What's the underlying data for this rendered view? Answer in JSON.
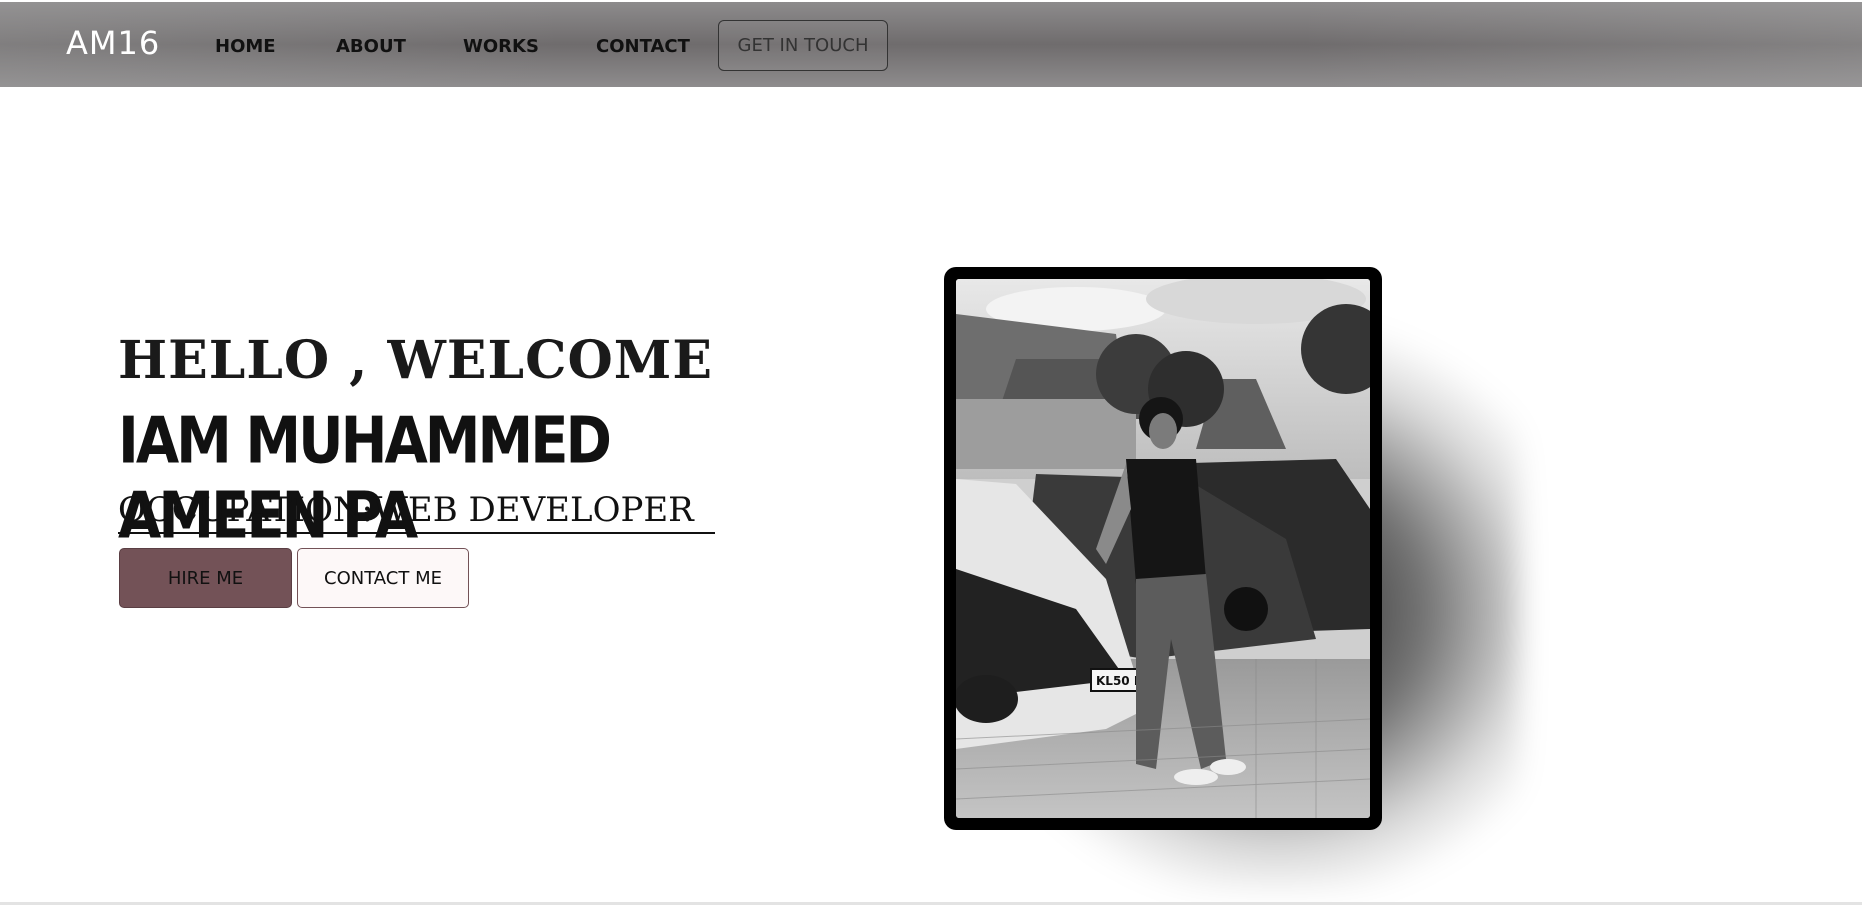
{
  "navbar": {
    "brand": "AM16",
    "links": [
      "HOME",
      "ABOUT",
      "WORKS",
      "CONTACT"
    ],
    "cta": "GET IN TOUCH"
  },
  "hero": {
    "greeting": "HELLO , WELCOME",
    "name": "IAM MUHAMMED AMEEN PA",
    "occupation": "OCCUPATION:WEB DEVELOPER",
    "hire_button": "HIRE ME",
    "contact_button": "CONTACT ME"
  },
  "photo": {
    "description_icon": "portrait-photo",
    "plate_text": "KL50 K 44"
  },
  "colors": {
    "accent": "#735257",
    "nav_bg": "#7a7778"
  }
}
